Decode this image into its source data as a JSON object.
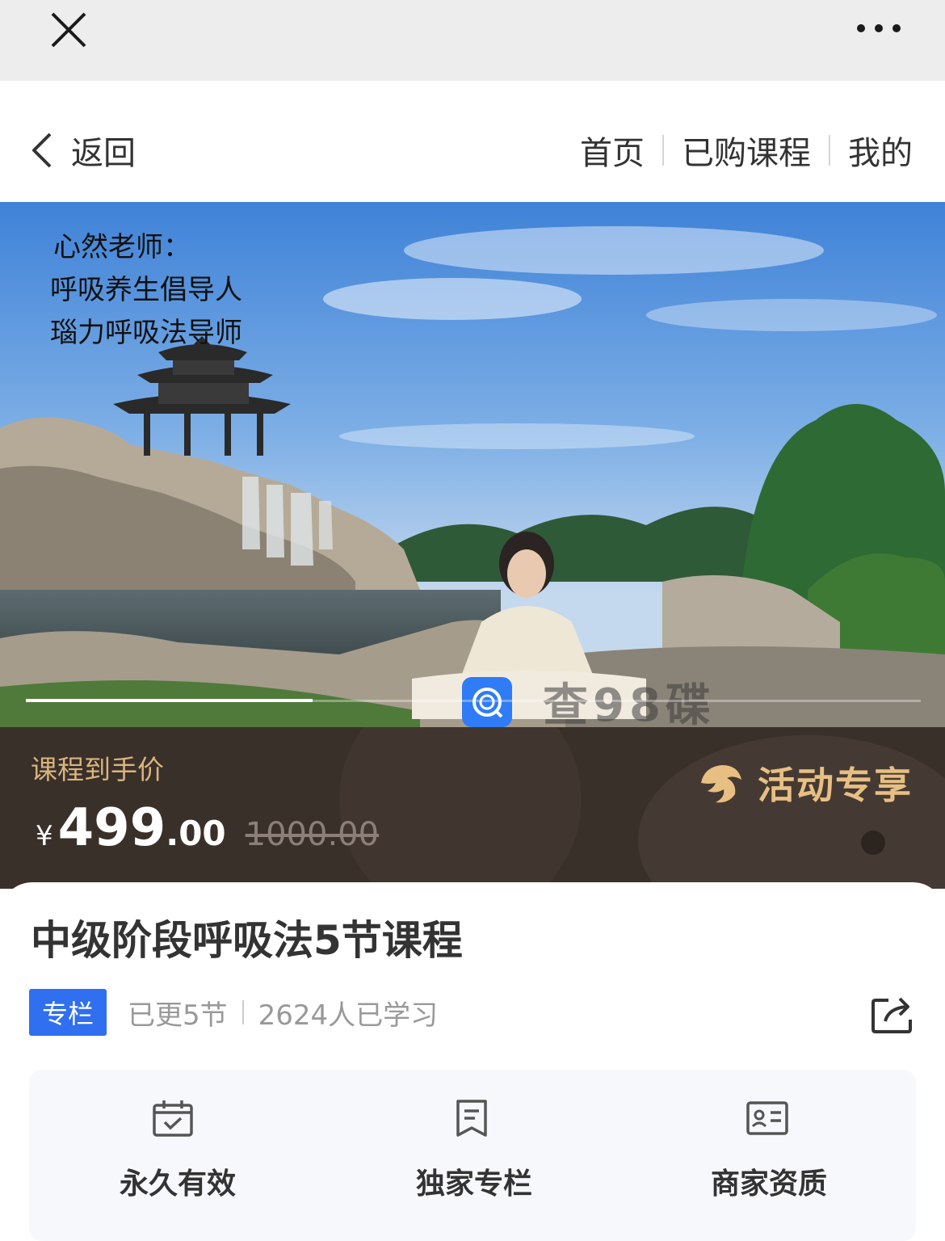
{
  "top_bar": {
    "close_icon": "close-icon",
    "more_icon": "more-dots-icon"
  },
  "nav": {
    "back_label": "返回",
    "links": [
      "首页",
      "已购课程",
      "我的"
    ]
  },
  "hero": {
    "lines": [
      "心然老师：",
      "呼吸养生倡导人",
      "瑙力呼吸法导师"
    ],
    "carousel_progress": 0.32,
    "watermark_text": "查98碟"
  },
  "price": {
    "label": "课程到手价",
    "currency": "¥",
    "integer": "499",
    "decimal": ".00",
    "original": "1000.00",
    "promo_text": "活动专享"
  },
  "course": {
    "title": "中级阶段呼吸法5节课程",
    "badge": "专栏",
    "updated": "已更5节",
    "learners": "2624人已学习"
  },
  "features": [
    {
      "label": "永久有效",
      "icon": "calendar-check-icon"
    },
    {
      "label": "独家专栏",
      "icon": "bookmark-doc-icon"
    },
    {
      "label": "商家资质",
      "icon": "id-card-icon"
    }
  ],
  "colors": {
    "accent_blue": "#2f6ff0",
    "price_gold": "#d9b47e",
    "strip_bg": "#3a302a"
  }
}
